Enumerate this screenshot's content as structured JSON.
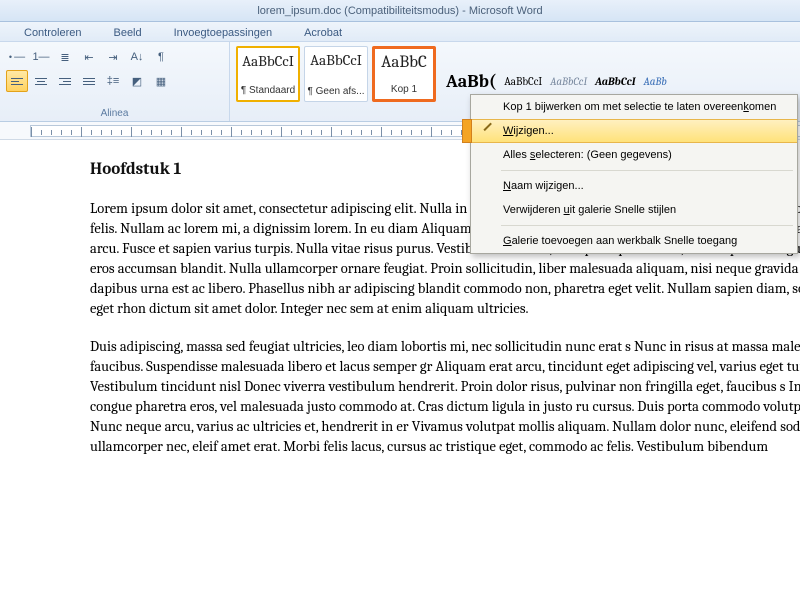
{
  "title": "lorem_ipsum.doc (Compatibiliteitsmodus) - Microsoft Word",
  "tabs": [
    "Controleren",
    "Beeld",
    "Invoegtoepassingen",
    "Acrobat"
  ],
  "ribbon": {
    "para_group_label": "Alinea",
    "styles": [
      {
        "sample": "AaBbCcI",
        "label": "¶ Standaard",
        "sampleClass": ""
      },
      {
        "sample": "AaBbCcI",
        "label": "¶ Geen afs...",
        "sampleClass": ""
      },
      {
        "sample": "AaBbC",
        "label": "Kop 1",
        "sampleClass": ""
      }
    ],
    "extra_styles": [
      {
        "text": "AaBb(",
        "style": "font-weight:bold;font-size:18px"
      },
      {
        "text": "AaBbCcI",
        "style": ""
      },
      {
        "text": "AaBbCcI",
        "style": "font-style:italic;color:#7a8aa0"
      },
      {
        "text": "AaBbCcI",
        "style": "font-weight:bold;font-style:italic"
      },
      {
        "text": "AaBb",
        "style": "color:#3a6fb7;font-style:italic"
      }
    ]
  },
  "context_menu": {
    "items": [
      {
        "label_pre": "Kop 1 bijwerken om met selectie te laten overeen",
        "key": "k",
        "label_post": "omen"
      },
      {
        "label_pre": "",
        "key": "W",
        "label_post": "ijzigen...",
        "selected": true,
        "icon": true
      },
      {
        "label_pre": "Alles ",
        "key": "s",
        "label_post": "electeren: (Geen gegevens)"
      },
      {
        "label_pre": "",
        "key": "N",
        "label_post": "aam wijzigen..."
      },
      {
        "label_pre": "Verwijderen ",
        "key": "u",
        "label_post": "it galerie Snelle stijlen"
      },
      {
        "label_pre": "",
        "key": "G",
        "label_post": "alerie toevoegen aan werkbalk Snelle toegang"
      }
    ]
  },
  "document": {
    "heading": "Hoofdstuk 1",
    "p1": "Lorem ipsum dolor sit amet, consectetur adipiscing elit. Nulla in dignissim augue. Nullam elementum enim. Donec nec tortor felis. Nullam ac lorem mi, a dignissim lorem. In eu diam Aliquam erat volutpat. Nullam et euismod odio. Praesent eget placerat arcu. Fusce et sapien varius turpis. Nulla vitae risus purus. Vestibulum erat mi, suscipit et posuere ac, varius quis e et ligula et eros accumsan blandit. Nulla ullamcorper ornare feugiat. Proin sollicitudin, liber malesuada aliquam, nisi neque gravida nisi, nec dapibus urna est ac libero. Phasellus nibh ar adipiscing blandit commodo non, pharetra eget velit. Nullam sapien diam, sodales eget rhon dictum sit amet dolor. Integer nec sem at enim aliquam ultricies.",
    "p2": "Duis adipiscing, massa sed feugiat ultricies, leo diam lobortis mi, nec sollicitudin nunc erat s Nunc in risus at massa malesuada faucibus. Suspendisse malesuada libero et lacus semper gr Aliquam erat arcu, tincidunt eget adipiscing vel, varius eget turpis. Vestibulum tincidunt nisl Donec viverra vestibulum hendrerit. Proin dolor risus, pulvinar non fringilla eget, faucibus s Integer congue pharetra eros, vel malesuada justo commodo at. Cras dictum ligula in justo ru cursus. Duis porta commodo volutpat. Nunc neque arcu, varius ac ultricies et, hendrerit in er Vivamus volutpat mollis aliquam. Nullam dolor nunc, eleifend sodales ullamcorper nec, eleif amet erat. Morbi felis lacus, cursus ac tristique eget, commodo ac felis. Vestibulum bibendum"
  }
}
